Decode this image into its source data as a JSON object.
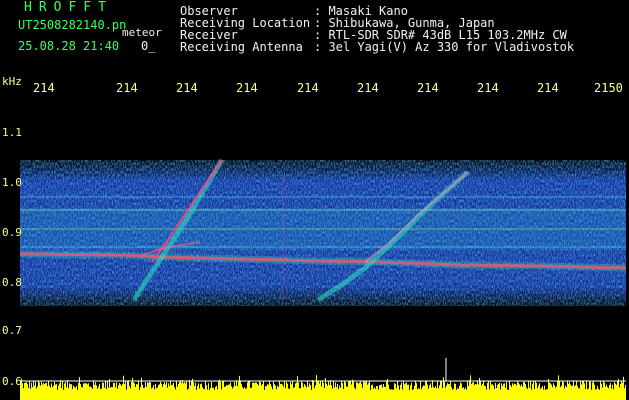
{
  "header": {
    "app_name": "HROFFT",
    "filename": "UT2508282140.pn",
    "tag": "meteor",
    "datetime": "25.08.28 21:40",
    "counter": "0_",
    "info": [
      {
        "label": "Observer",
        "value": ": Masaki Kano"
      },
      {
        "label": "Receiving Location",
        "value": ": Shibukawa, Gunma, Japan"
      },
      {
        "label": "Receiver",
        "value": ": RTL-SDR SDR# 43dB L15 103.2MHz CW"
      },
      {
        "label": "Receiving Antenna",
        "value": ": 3el Yagi(V) Az 330 for Vladivostok"
      }
    ]
  },
  "spectrogram": {
    "freq_unit": "kHz",
    "time_ticks": [
      "214",
      "214",
      "214",
      "214",
      "214",
      "214",
      "214",
      "214",
      "214",
      "2150"
    ],
    "freq_ticks": [
      "1.1",
      "1.0",
      "0.9",
      "0.8",
      "0.7",
      "0.6"
    ],
    "colors": {
      "background": "#000000",
      "echo": "#ff2a6e",
      "noise_high": "#29c9e8",
      "noise_low": "#1d3fd0",
      "level": "#ffff00"
    }
  }
}
